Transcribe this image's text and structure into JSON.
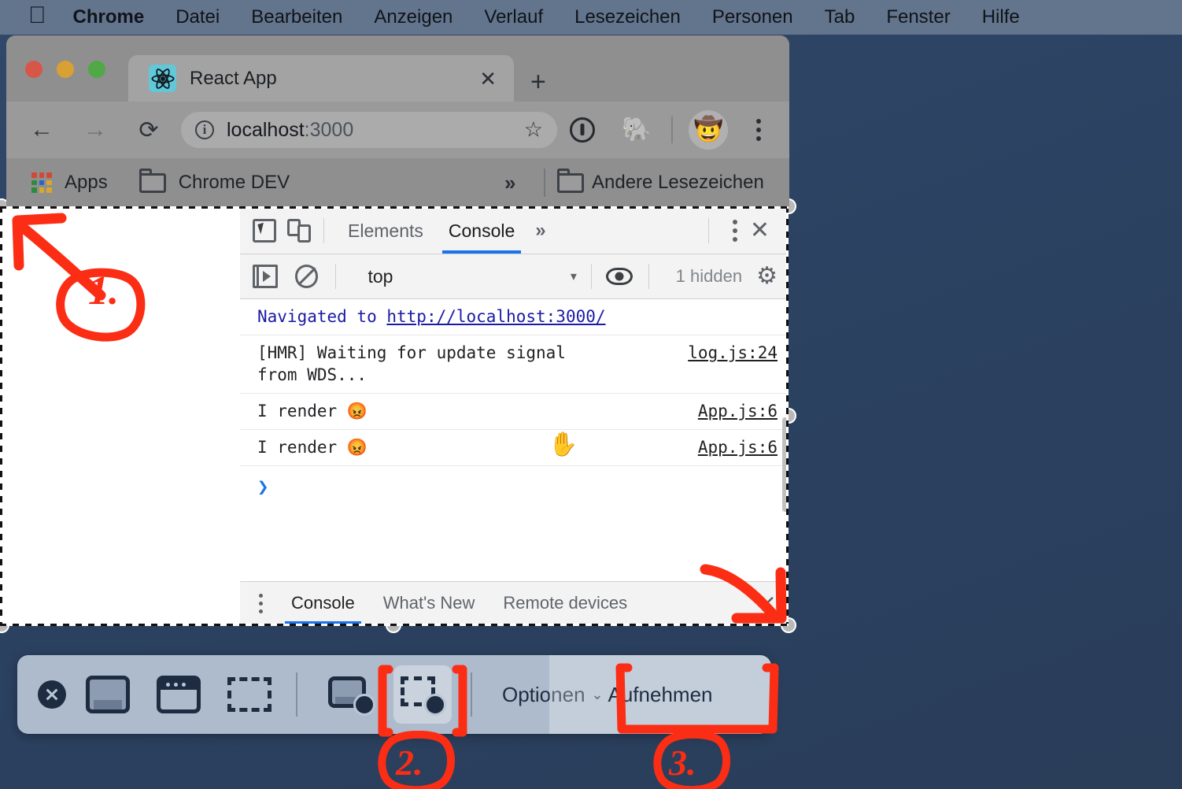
{
  "menubar": {
    "apple_icon": "apple-logo",
    "items": [
      {
        "label": "Chrome",
        "bold": true
      },
      {
        "label": "Datei",
        "bold": false
      },
      {
        "label": "Bearbeiten",
        "bold": false
      },
      {
        "label": "Anzeigen",
        "bold": false
      },
      {
        "label": "Verlauf",
        "bold": false
      },
      {
        "label": "Lesezeichen",
        "bold": false
      },
      {
        "label": "Personen",
        "bold": false
      },
      {
        "label": "Tab",
        "bold": false
      },
      {
        "label": "Fenster",
        "bold": false
      },
      {
        "label": "Hilfe",
        "bold": false
      }
    ]
  },
  "browser": {
    "tab": {
      "title": "React App",
      "favicon": "react-logo-icon",
      "close_label": "✕"
    },
    "new_tab_label": "+",
    "nav": {
      "back": "←",
      "forward": "→",
      "reload": "⟳"
    },
    "omnibox": {
      "host": "localhost",
      "port": ":3000",
      "security_icon": "info-circle-icon",
      "bookmark_star": "☆"
    },
    "toolbar_extensions": {
      "onepassword": "1password-icon",
      "evernote": "🐘",
      "avatar": "🤠",
      "menu": "three-dot-menu-icon"
    },
    "bookmarks": {
      "apps_label": "Apps",
      "folder_label": "Chrome DEV",
      "overflow": "»",
      "other_label": "Andere Lesezeichen"
    }
  },
  "devtools": {
    "toolbar": {
      "inspect_icon": "inspect-element-icon",
      "device_icon": "device-toolbar-icon",
      "tabs": [
        {
          "label": "Elements",
          "active": false
        },
        {
          "label": "Console",
          "active": true
        }
      ],
      "more_tabs": "»",
      "menu_icon": "three-dot-menu-icon",
      "close_label": "✕"
    },
    "filterbar": {
      "sidebar_icon": "console-sidebar-icon",
      "clear_icon": "clear-console-icon",
      "context": "top",
      "context_arrow": "▾",
      "eye_icon": "live-expression-icon",
      "hidden_count": "1 hidden",
      "settings_icon": "gear-icon"
    },
    "console_rows": [
      {
        "message": "Navigated to ",
        "link": "http://localhost:3000/",
        "source": "",
        "type": "navigation"
      },
      {
        "message": "[HMR] Waiting for update signal\nfrom WDS...",
        "link": "",
        "source": "log.js:24",
        "type": "log"
      },
      {
        "message": "I render 😡",
        "link": "",
        "source": "App.js:6",
        "type": "log"
      },
      {
        "message": "I render 😡",
        "link": "",
        "source": "App.js:6",
        "type": "log"
      }
    ],
    "prompt_symbol": "❯",
    "drawer": {
      "menu_icon": "three-dot-menu-icon",
      "tabs": [
        {
          "label": "Console",
          "active": true
        },
        {
          "label": "What's New",
          "active": false
        },
        {
          "label": "Remote devices",
          "active": false
        }
      ],
      "close_label": "✕"
    }
  },
  "screenshot_toolbar": {
    "close_icon": "close-capture-icon",
    "buttons": [
      {
        "name": "capture-entire-screen",
        "selected": false
      },
      {
        "name": "capture-selected-window",
        "selected": false
      },
      {
        "name": "capture-selected-portion",
        "selected": false
      },
      {
        "name": "record-entire-screen",
        "selected": false
      },
      {
        "name": "record-selected-portion",
        "selected": true
      }
    ],
    "options_label": "Optionen",
    "options_chevron": "⌄",
    "capture_label": "Aufnehmen"
  },
  "annotations": {
    "accent_color": "#fb2d14",
    "markers": [
      {
        "label": "1.",
        "target": "selection-region"
      },
      {
        "label": "2.",
        "target": "record-selected-portion-button"
      },
      {
        "label": "3.",
        "target": "capture-button"
      }
    ]
  },
  "colors": {
    "desktop": "#2b4160",
    "menubar": "#63758c",
    "devtools_accent": "#1a73e8",
    "toolbar_bg": "#bac6d6",
    "annotation_red": "#fb2d14"
  }
}
